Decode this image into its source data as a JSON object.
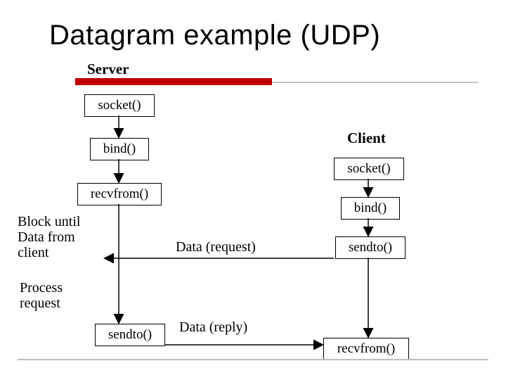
{
  "title": "Datagram example (UDP)",
  "server_label": "Server",
  "client_label": "Client",
  "server_steps": {
    "s1": "socket()",
    "s2": "bind()",
    "s3": "recvfrom()",
    "s4": "sendto()"
  },
  "client_steps": {
    "c1": "socket()",
    "c2": "bind()",
    "c3": "sendto()",
    "c4": "recvfrom()"
  },
  "notes": {
    "block": "Block until\nData from\nclient",
    "process": "Process\nrequest"
  },
  "messages": {
    "req": "Data (request)",
    "rep": "Data (reply)"
  }
}
